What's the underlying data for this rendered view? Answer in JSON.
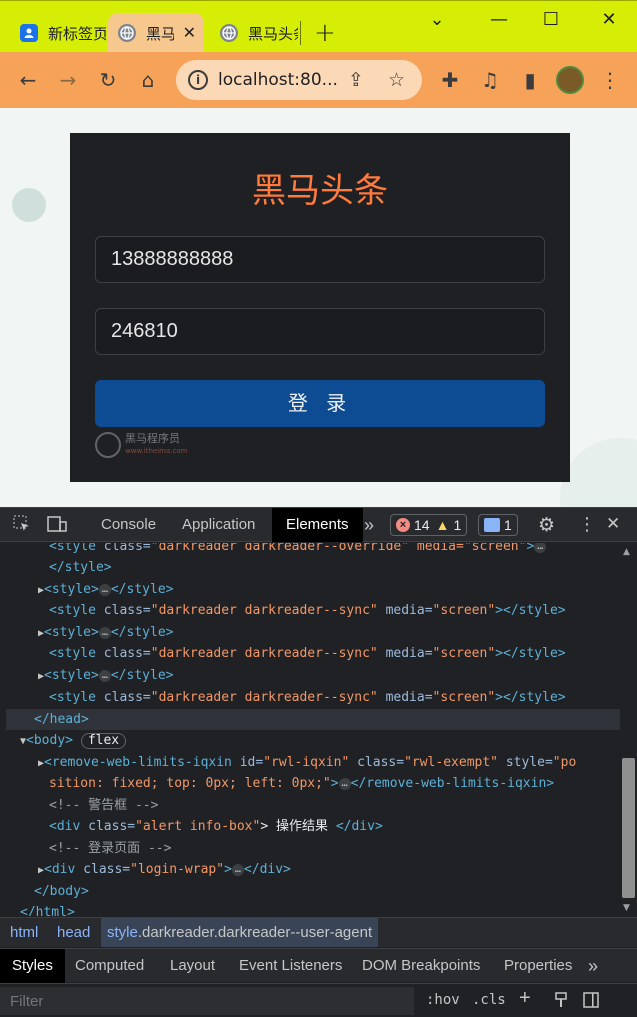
{
  "browser": {
    "tabs": [
      {
        "title": "新标签页",
        "favicon": "new-tab-page-icon"
      },
      {
        "title": "黑马头条",
        "favicon": "globe-icon",
        "active": true
      },
      {
        "title": "黑马头条",
        "favicon": "globe-icon"
      }
    ],
    "tab_close": "✕",
    "new_tab": "+",
    "window": {
      "minimize": "⌄",
      "restore": "—",
      "maximize": "☐",
      "close": "✕"
    },
    "tabstrip_color": "#d6ee05",
    "toolbar_color": "#f6a359",
    "url": "localhost:80...",
    "info_glyph": "i",
    "icons": {
      "back": "←",
      "forward": "→",
      "reload": "↻",
      "home": "⌂",
      "share": "⇪",
      "star": "☆",
      "extensions": "✚",
      "media": "♫",
      "sidepanel": "▮",
      "menu": "⋮"
    }
  },
  "page": {
    "title": "黑马头条",
    "title_color": "#ff7a3d",
    "mobile_value": "13888888888",
    "code_value": "246810",
    "login_button": "登 录",
    "button_color": "#0d4b92",
    "watermark_line1": "黑马程序员",
    "watermark_line2": "www.itheima.com"
  },
  "devtools": {
    "tabs": [
      "Console",
      "Application",
      "Elements"
    ],
    "active_tab": "Elements",
    "more_tabs": "»",
    "errors": "14",
    "warnings": "1",
    "messages": "1",
    "dom": {
      "l0_tag_open": "<style",
      "l0_attr": "class=",
      "l0_val": "\"darkreader darkreader--override\" media=\"screen\"",
      "l0_close": ">",
      "style_close": "</style>",
      "style_open": "<style>",
      "ellipsis": "…",
      "sync_open": "<style",
      "sync_cls": "class=",
      "sync_val": "\"darkreader darkreader--sync\"",
      "sync_media": "media=",
      "sync_media_val": "\"screen\"",
      "sync_end": "></style>",
      "head_close": "</head>",
      "body_open": "<body>",
      "flex_badge": "flex",
      "rwl_tag": "<remove-web-limits-iqxin",
      "rwl_id_attr": "id=",
      "rwl_id_val": "\"rwl-iqxin\"",
      "rwl_class_attr": "class=",
      "rwl_class_val": "\"rwl-exempt\"",
      "rwl_style_attr": "style=",
      "rwl_style_val1": "\"po",
      "rwl_style_val2": "sition: fixed; top: 0px; left: 0px;\"",
      "rwl_end_close": ">",
      "rwl_close": "</remove-web-limits-iqxin>",
      "comment_alert": "<!-- 警告框 -->",
      "div_alert_open": "<div",
      "div_alert_attr": "class=",
      "div_alert_val": "\"alert info-box\"",
      "div_alert_text": "> 操作结果 ",
      "div_close": "</div>",
      "comment_login": "<!-- 登录页面 -->",
      "div_login_open": "<div",
      "div_login_attr": "class=",
      "div_login_val": "\"login-wrap\"",
      "gt": ">",
      "body_close": "</body>",
      "html_close": "</html>"
    },
    "breadcrumbs": {
      "html": "html",
      "head": "head",
      "selected_tag": "style",
      "selected_classes": ".darkreader.darkreader--user-agent"
    },
    "styles_tabs": [
      "Styles",
      "Computed",
      "Layout",
      "Event Listeners",
      "DOM Breakpoints",
      "Properties"
    ],
    "styles_more": "»",
    "filter_placeholder": "Filter",
    "hov": ":hov",
    "cls": ".cls",
    "plus": "+"
  }
}
